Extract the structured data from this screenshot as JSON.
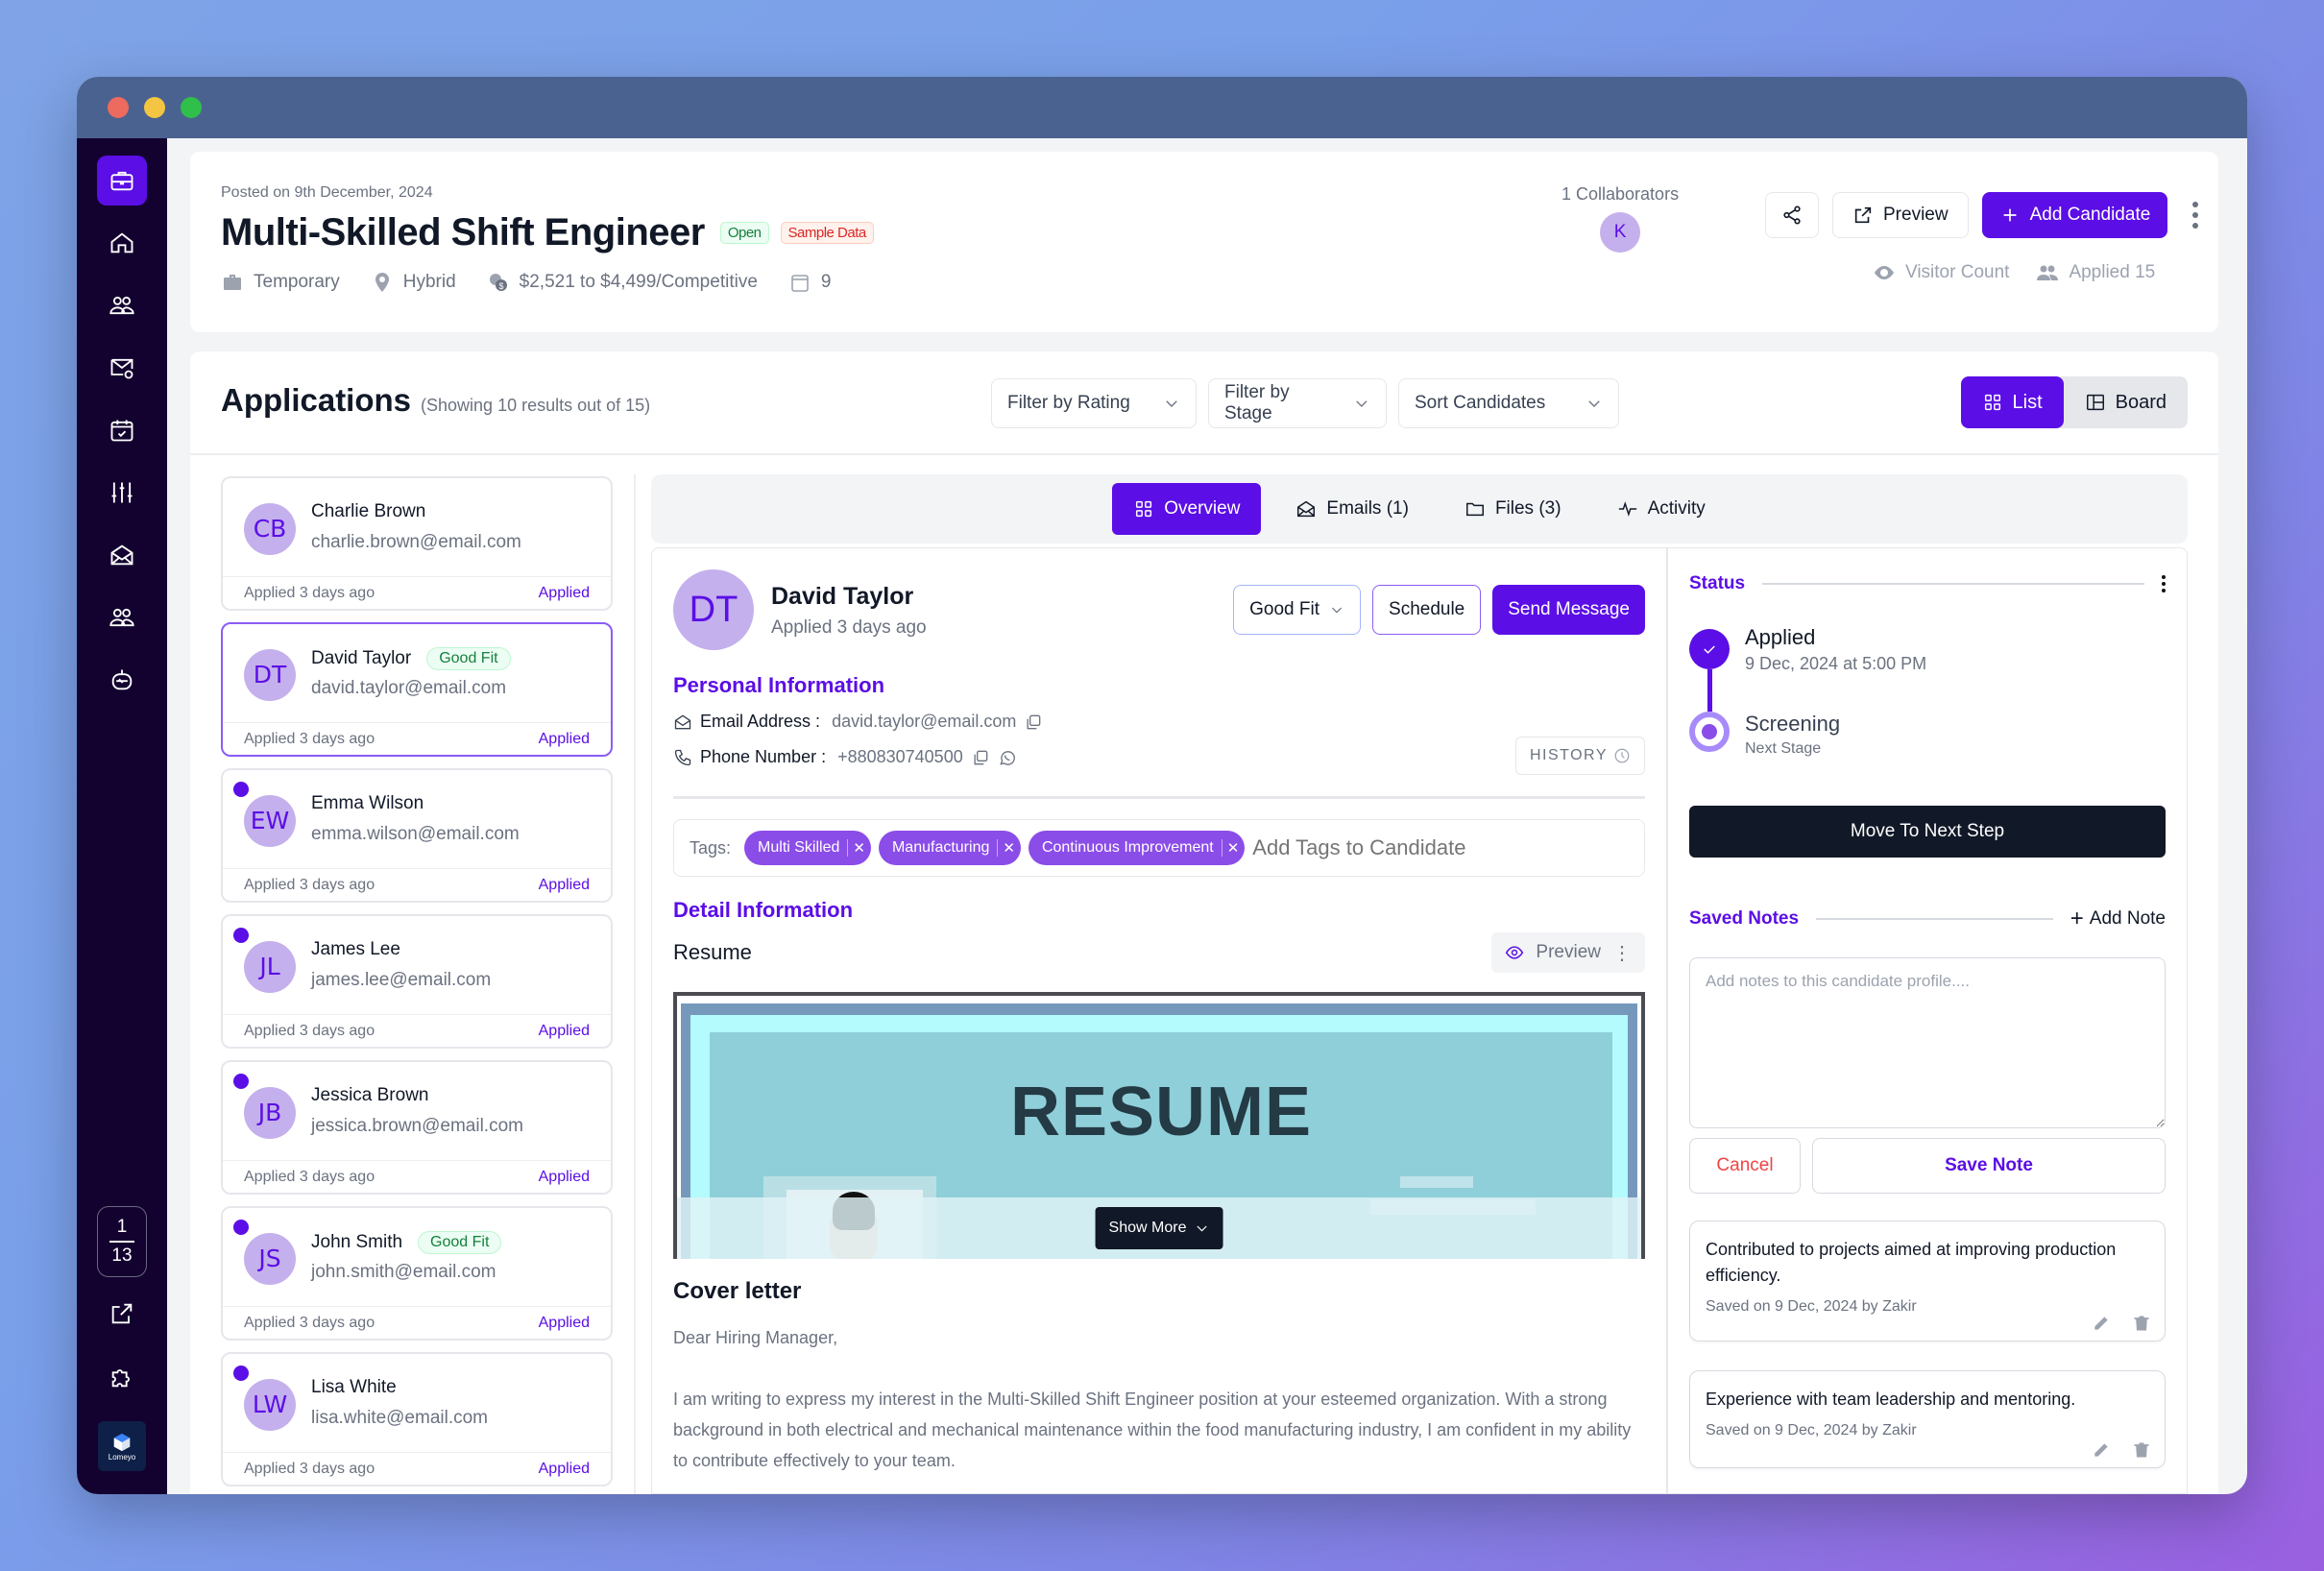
{
  "window": {
    "controls": [
      "close",
      "minimize",
      "maximize"
    ],
    "colors": {
      "close": "#ec6a5e",
      "minimize": "#f4c542",
      "maximize": "#2fbf4a"
    }
  },
  "sidebar": {
    "items": [
      {
        "name": "jobs",
        "icon": "briefcase-icon",
        "active": true
      },
      {
        "name": "home",
        "icon": "home-icon"
      },
      {
        "name": "candidates",
        "icon": "users-icon"
      },
      {
        "name": "email-campaigns",
        "icon": "mail-at-icon"
      },
      {
        "name": "calendar",
        "icon": "calendar-check-icon"
      },
      {
        "name": "settings",
        "icon": "sliders-icon"
      },
      {
        "name": "inbox",
        "icon": "envelope-open-icon"
      },
      {
        "name": "team",
        "icon": "users-icon"
      },
      {
        "name": "ai-assistant",
        "icon": "robot-icon"
      }
    ],
    "page_counter": {
      "current": "1",
      "total": "13"
    },
    "bottom": [
      {
        "name": "open-external",
        "icon": "external-link-icon"
      },
      {
        "name": "integrations",
        "icon": "puzzle-icon"
      }
    ],
    "logo_text": "Lomeyo"
  },
  "job": {
    "posted": "Posted on 9th December, 2024",
    "title": "Multi-Skilled Shift Engineer",
    "status_badge": "Open",
    "sample_badge": "Sample Data",
    "employment_type": "Temporary",
    "location": "Hybrid",
    "salary": "$2,521 to $4,499/Competitive",
    "calendar_count": "9",
    "collaborators_label": "1 Collaborators",
    "collaborator_initial": "K",
    "preview_label": "Preview",
    "add_candidate_label": "Add Candidate",
    "visitor_label": "Visitor Count",
    "applied_label": "Applied 15"
  },
  "applications": {
    "title": "Applications",
    "subtitle": "(Showing 10 results out of 15)",
    "filters": [
      "Filter by Rating",
      "Filter by Stage",
      "Sort Candidates"
    ],
    "view_list": "List",
    "view_board": "Board",
    "candidates": [
      {
        "initials": "CB",
        "name": "Charlie Brown",
        "email": "charlie.brown@email.com",
        "applied": "Applied 3 days ago",
        "status": "Applied",
        "badge": "",
        "unread": false,
        "selected": false
      },
      {
        "initials": "DT",
        "name": "David Taylor",
        "email": "david.taylor@email.com",
        "applied": "Applied 3 days ago",
        "status": "Applied",
        "badge": "Good Fit",
        "unread": false,
        "selected": true
      },
      {
        "initials": "EW",
        "name": "Emma Wilson",
        "email": "emma.wilson@email.com",
        "applied": "Applied 3 days ago",
        "status": "Applied",
        "badge": "",
        "unread": true,
        "selected": false
      },
      {
        "initials": "JL",
        "name": "James Lee",
        "email": "james.lee@email.com",
        "applied": "Applied 3 days ago",
        "status": "Applied",
        "badge": "",
        "unread": true,
        "selected": false
      },
      {
        "initials": "JB",
        "name": "Jessica Brown",
        "email": "jessica.brown@email.com",
        "applied": "Applied 3 days ago",
        "status": "Applied",
        "badge": "",
        "unread": true,
        "selected": false
      },
      {
        "initials": "JS",
        "name": "John Smith",
        "email": "john.smith@email.com",
        "applied": "Applied 3 days ago",
        "status": "Applied",
        "badge": "Good Fit",
        "unread": true,
        "selected": false
      },
      {
        "initials": "LW",
        "name": "Lisa White",
        "email": "lisa.white@email.com",
        "applied": "Applied 3 days ago",
        "status": "Applied",
        "badge": "",
        "unread": true,
        "selected": false
      }
    ]
  },
  "detail": {
    "tabs": [
      {
        "label": "Overview",
        "icon": "grid-icon",
        "active": true
      },
      {
        "label": "Emails (1)",
        "icon": "envelope-open-icon"
      },
      {
        "label": "Files (3)",
        "icon": "folder-icon"
      },
      {
        "label": "Activity",
        "icon": "activity-icon"
      }
    ],
    "initials": "DT",
    "name": "David Taylor",
    "applied": "Applied 3 days ago",
    "fit_label": "Good Fit",
    "schedule_label": "Schedule",
    "send_message_label": "Send Message",
    "personal_info_title": "Personal Information",
    "email_label": "Email Address :",
    "email_value": "david.taylor@email.com",
    "phone_label": "Phone Number :",
    "phone_value": "+880830740500",
    "history_label": "HISTORY",
    "tags_label": "Tags:",
    "tags": [
      "Multi Skilled",
      "Manufacturing",
      "Continuous Improvement"
    ],
    "tags_placeholder": "Add Tags to Candidate",
    "detail_info_title": "Detail Information",
    "resume_label": "Resume",
    "resume_preview_label": "Preview",
    "resume_image_text": "RESUME",
    "show_more_label": "Show More",
    "cover_title": "Cover letter",
    "cover_greeting": "Dear Hiring Manager,",
    "cover_body": "I am writing to express my interest in the Multi-Skilled Shift Engineer position at your esteemed organization. With a strong background in both electrical and mechanical maintenance within the food manufacturing industry, I am confident in my ability to contribute effectively to your team."
  },
  "status_panel": {
    "title": "Status",
    "steps": [
      {
        "label": "Applied",
        "sub": "9 Dec, 2024 at 5:00 PM",
        "state": "done"
      },
      {
        "label": "Screening",
        "sub": "Next Stage",
        "state": "next"
      }
    ],
    "move_label": "Move To Next Step",
    "notes_title": "Saved Notes",
    "add_note_label": "Add Note",
    "note_placeholder": "Add notes to this candidate profile....",
    "cancel_label": "Cancel",
    "save_label": "Save Note",
    "notes": [
      {
        "text": "Contributed to projects aimed at improving production efficiency.",
        "meta": "Saved on 9 Dec, 2024 by Zakir"
      },
      {
        "text": "Experience with team leadership and mentoring.",
        "meta": "Saved on 9 Dec, 2024 by Zakir"
      }
    ]
  },
  "colors": {
    "brand": "#5b0ee6",
    "sidebar": "#13022f",
    "avatar_bg": "#c4b0ec",
    "tag_bg": "#8b4de8",
    "good_fit": "#15803d",
    "danger": "#ef4444",
    "dark": "#111827"
  }
}
